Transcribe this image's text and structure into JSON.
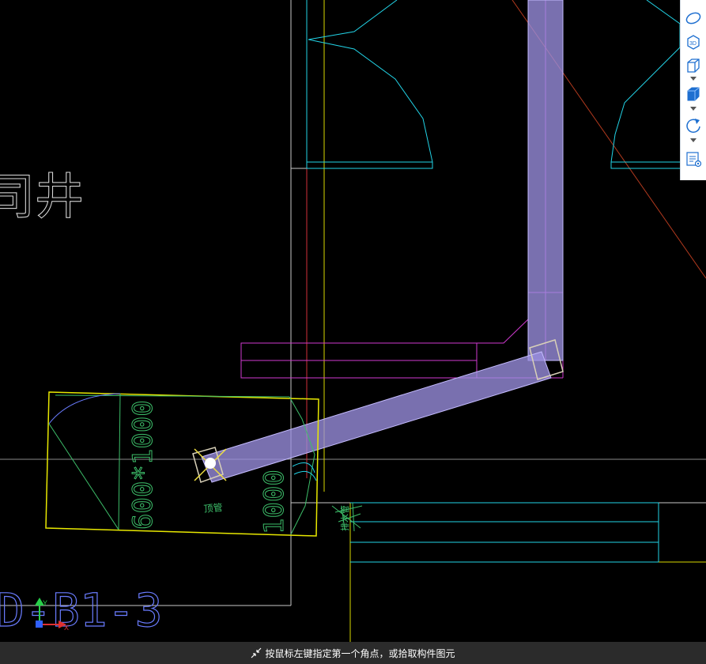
{
  "drawing": {
    "section_mark": "D-B1-3",
    "dimension_label": "600*1000",
    "height_label": "1000",
    "partial_room_name": "司井",
    "small_tag": "顶管",
    "side_tag": "排水管"
  },
  "toolbar": {
    "buttons": [
      {
        "icon": "orbit-icon"
      },
      {
        "icon": "3d-view-icon",
        "label": "3D"
      },
      {
        "icon": "view-cube-icon"
      },
      {
        "icon": "solid-display-icon"
      },
      {
        "icon": "rotate-icon"
      },
      {
        "icon": "layer-display-icon"
      }
    ]
  },
  "status": {
    "prompt": "按鼠标左键指定第一个角点，或拾取构件图元"
  },
  "ucs": {
    "x_label": "X",
    "y_label": "Y"
  }
}
